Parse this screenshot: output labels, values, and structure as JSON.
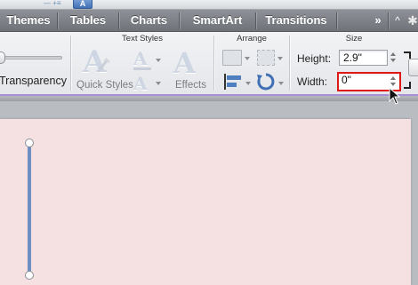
{
  "tabs": [
    "Themes",
    "Tables",
    "Charts",
    "SmartArt",
    "Transitions"
  ],
  "tabbar": {
    "more": "»",
    "caret": "^",
    "gear": "✱"
  },
  "ribbon": {
    "transparency_label": "Transparency",
    "text_styles": {
      "title": "Text Styles",
      "quick_styles_label": "Quick Styles",
      "effects_label": "Effects"
    },
    "arrange": {
      "title": "Arrange"
    },
    "size": {
      "title": "Size",
      "height_label": "Height:",
      "height_value": "2.9\"",
      "width_label": "Width:",
      "width_value": "0\""
    }
  },
  "colors": {
    "highlight": "#e01818",
    "slide_bg": "#f5e1e1",
    "line": "#6f8fc3"
  }
}
